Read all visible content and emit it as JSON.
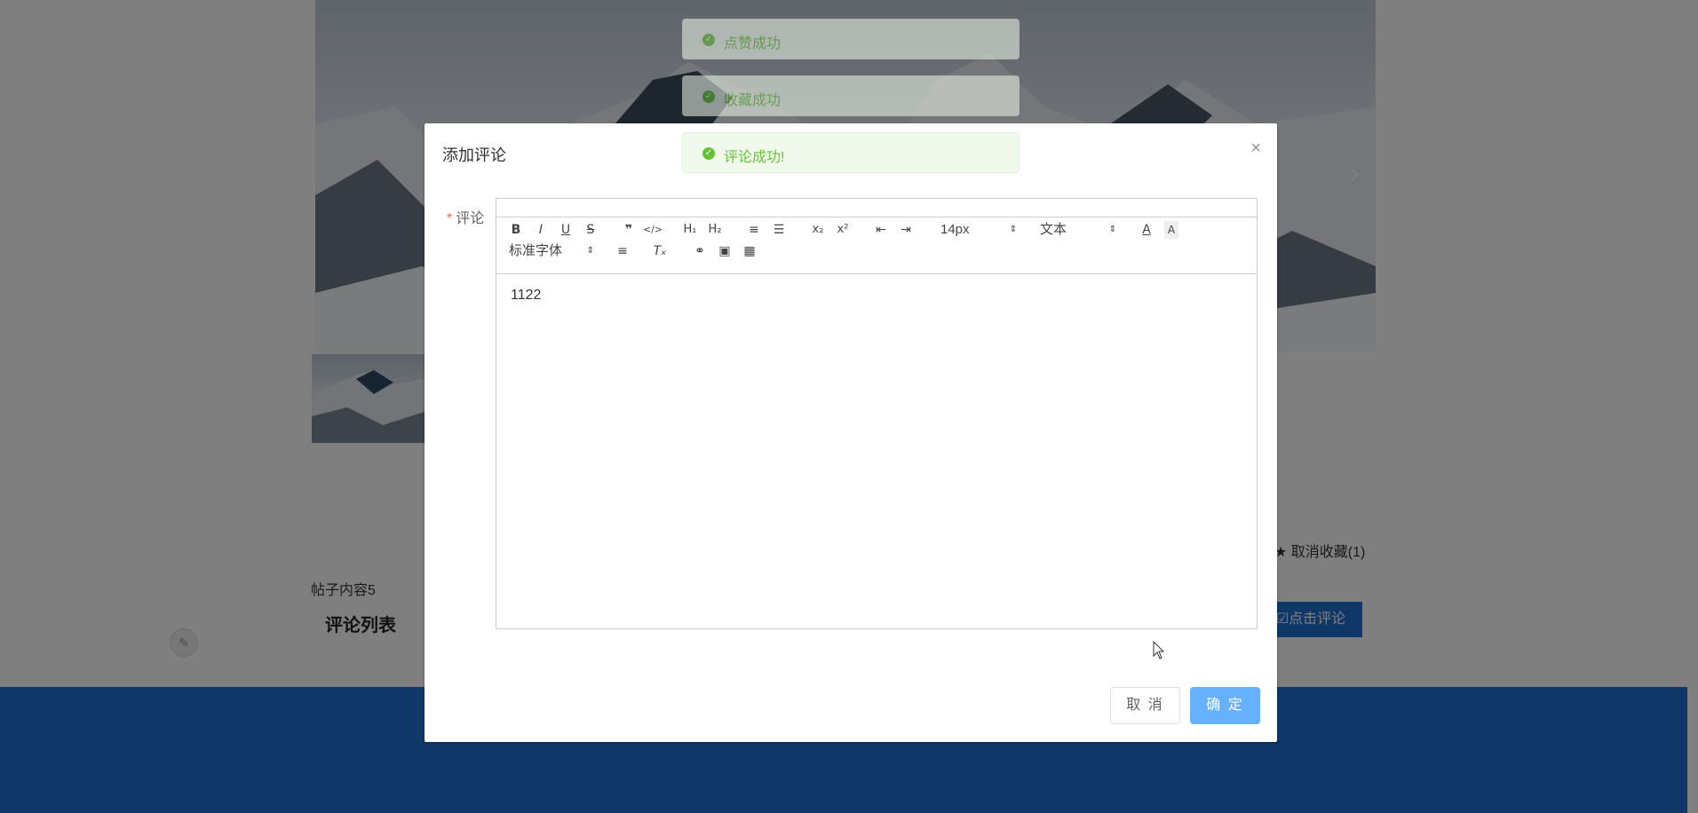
{
  "page": {
    "post_content": "帖子内容5",
    "comment_list_title": "评论列表",
    "favorite_toggle": "取消收藏(1)",
    "comment_button": "点击评论",
    "carousel_next": "›"
  },
  "dialog": {
    "title": "添加评论",
    "close": "×",
    "field_required_mark": "*",
    "field_label": "评论",
    "editor": {
      "toolbar": {
        "bold": "B",
        "italic": "I",
        "underline": "U",
        "strike": "S",
        "blockquote": "❞",
        "code": "</>",
        "h1": "H₁",
        "h2": "H₂",
        "ordered_list": "≡",
        "bullet_list": "☰",
        "subscript": "x₂",
        "superscript": "x²",
        "outdent": "⇤",
        "indent": "⇥",
        "size_select": "14px",
        "header_select": "文本",
        "font_select": "标准字体",
        "color": "A",
        "background": "A",
        "align": "≡",
        "clean": "Tₓ",
        "link": "⚭",
        "image": "▣",
        "video": "▦"
      },
      "content": "1122"
    },
    "cancel_label": "取 消",
    "ok_label": "确 定"
  },
  "toasts": [
    {
      "text": "点赞成功",
      "type": "success"
    },
    {
      "text": "收藏成功",
      "type": "success"
    },
    {
      "text": "评论成功!",
      "type": "success"
    }
  ],
  "colors": {
    "primary": "#1f6fd1",
    "success": "#67c23a",
    "ok_button": "#66b1ff",
    "required": "#f56c6c"
  }
}
